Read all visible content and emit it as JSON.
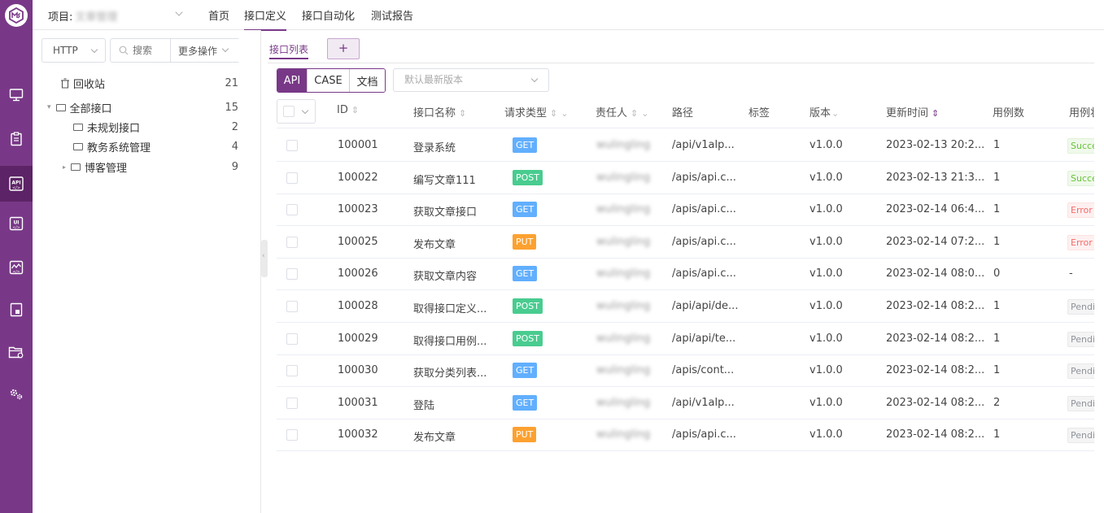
{
  "colors": {
    "brand": "#783887",
    "get": "#61affe",
    "post": "#49cc90",
    "put": "#fca130",
    "success_text": "#67c23a",
    "error_text": "#f56c6c",
    "pending_text": "#909399"
  },
  "header": {
    "project_label": "项目:",
    "project_name": "文章管理",
    "nav": [
      "首页",
      "接口定义",
      "接口自动化",
      "测试报告"
    ],
    "active_nav": "接口定义"
  },
  "sidebar_icons": [
    "monitor-icon",
    "clipboard-icon",
    "api-icon",
    "ui-icon",
    "performance-icon",
    "report-icon",
    "project-folder-icon",
    "settings-icon"
  ],
  "tree": {
    "protocol": "HTTP",
    "search_placeholder": "搜索",
    "more_label": "更多操作",
    "items": [
      {
        "label": "回收站",
        "count": "21"
      },
      {
        "label": "全部接口",
        "count": "15"
      },
      {
        "label": "未规划接口",
        "count": "2"
      },
      {
        "label": "教务系统管理",
        "count": "4"
      },
      {
        "label": "博客管理",
        "count": "9"
      }
    ]
  },
  "tabs": {
    "list_tab": "接口列表",
    "add_tab": "+"
  },
  "mode": {
    "options": [
      "API",
      "CASE",
      "文档"
    ],
    "selected": "API"
  },
  "version_select": {
    "placeholder": "默认最新版本"
  },
  "table": {
    "headers": {
      "id": "ID",
      "name": "接口名称",
      "method": "请求类型",
      "owner": "责任人",
      "path": "路径",
      "tags": "标签",
      "version": "版本",
      "updated": "更新时间",
      "case_count": "用例数",
      "case_status": "用例状态"
    },
    "rows": [
      {
        "id": "100001",
        "name": "登录系统",
        "method": "GET",
        "owner": "wulingling",
        "path": "/api/v1alp...",
        "version": "v1.0.0",
        "updated": "2023-02-13 20:2...",
        "case_count": "1",
        "status": "Success"
      },
      {
        "id": "100022",
        "name": "编写文章111",
        "method": "POST",
        "owner": "wulingling",
        "path": "/apis/api.c...",
        "version": "v1.0.0",
        "updated": "2023-02-13 21:3...",
        "case_count": "1",
        "status": "Success"
      },
      {
        "id": "100023",
        "name": "获取文章接口",
        "method": "GET",
        "owner": "wulingling",
        "path": "/apis/api.c...",
        "version": "v1.0.0",
        "updated": "2023-02-14 06:4...",
        "case_count": "1",
        "status": "Error"
      },
      {
        "id": "100025",
        "name": "发布文章",
        "method": "PUT",
        "owner": "wulingling",
        "path": "/apis/api.c...",
        "version": "v1.0.0",
        "updated": "2023-02-14 07:2...",
        "case_count": "1",
        "status": "Error"
      },
      {
        "id": "100026",
        "name": "获取文章内容",
        "method": "GET",
        "owner": "wulingling",
        "path": "/apis/api.c...",
        "version": "v1.0.0",
        "updated": "2023-02-14 08:0...",
        "case_count": "0",
        "status": "-"
      },
      {
        "id": "100028",
        "name": "取得接口定义...",
        "method": "POST",
        "owner": "wulingling",
        "path": "/api/api/de...",
        "version": "v1.0.0",
        "updated": "2023-02-14 08:2...",
        "case_count": "1",
        "status": "Pending"
      },
      {
        "id": "100029",
        "name": "取得接口用例...",
        "method": "POST",
        "owner": "wulingling",
        "path": "/api/api/te...",
        "version": "v1.0.0",
        "updated": "2023-02-14 08:2...",
        "case_count": "1",
        "status": "Pending"
      },
      {
        "id": "100030",
        "name": "获取分类列表...",
        "method": "GET",
        "owner": "wulingling",
        "path": "/apis/cont...",
        "version": "v1.0.0",
        "updated": "2023-02-14 08:2...",
        "case_count": "1",
        "status": "Pending"
      },
      {
        "id": "100031",
        "name": "登陆",
        "method": "GET",
        "owner": "wulingling",
        "path": "/api/v1alp...",
        "version": "v1.0.0",
        "updated": "2023-02-14 08:2...",
        "case_count": "2",
        "status": "Pending"
      },
      {
        "id": "100032",
        "name": "发布文章",
        "method": "PUT",
        "owner": "wulingling",
        "path": "/apis/api.c...",
        "version": "v1.0.0",
        "updated": "2023-02-14 08:2...",
        "case_count": "1",
        "status": "Pending"
      }
    ]
  }
}
